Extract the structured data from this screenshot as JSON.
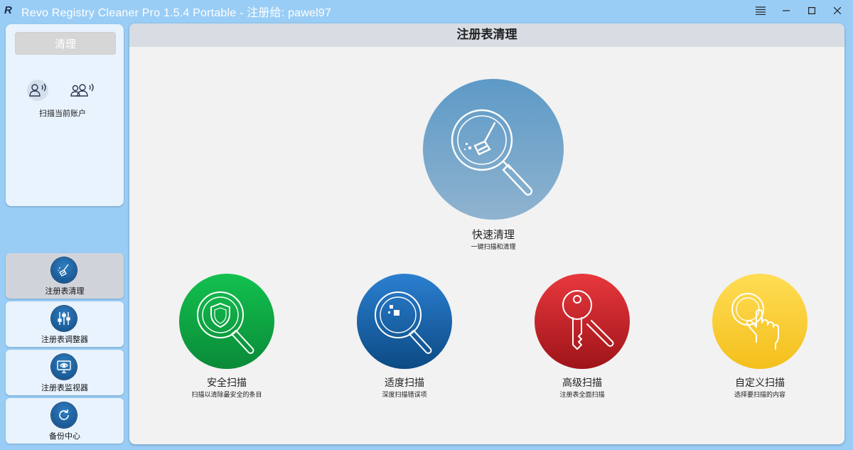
{
  "window": {
    "title": "Revo Registry Cleaner Pro 1.5.4 Portable - 注册给: pawel97",
    "logo_letter": "R"
  },
  "left_panel": {
    "clean_button": "清理",
    "scan_account_label": "扫描当前账户"
  },
  "nav": [
    {
      "label": "注册表清理",
      "icon": "broom-icon",
      "active": true
    },
    {
      "label": "注册表调整器",
      "icon": "sliders-icon",
      "active": false
    },
    {
      "label": "注册表监视器",
      "icon": "monitor-eye-icon",
      "active": false
    },
    {
      "label": "备份中心",
      "icon": "refresh-icon",
      "active": false
    }
  ],
  "main": {
    "header": "注册表清理",
    "quick_clean": {
      "title": "快速清理",
      "subtitle": "一键扫描和清理"
    },
    "scans": [
      {
        "title": "安全扫描",
        "subtitle": "扫描以清除最安全的条目",
        "color": "#1aa845"
      },
      {
        "title": "适度扫描",
        "subtitle": "深度扫描错误项",
        "color": "#1a5fa0"
      },
      {
        "title": "高级扫描",
        "subtitle": "注册表全面扫描",
        "color": "#c7262b"
      },
      {
        "title": "自定义扫描",
        "subtitle": "选择要扫描的内容",
        "color": "#f5c623"
      }
    ]
  },
  "colors": {
    "background": "#99cdf6",
    "panel": "#e8f3fd",
    "main": "#f2f2f2"
  }
}
